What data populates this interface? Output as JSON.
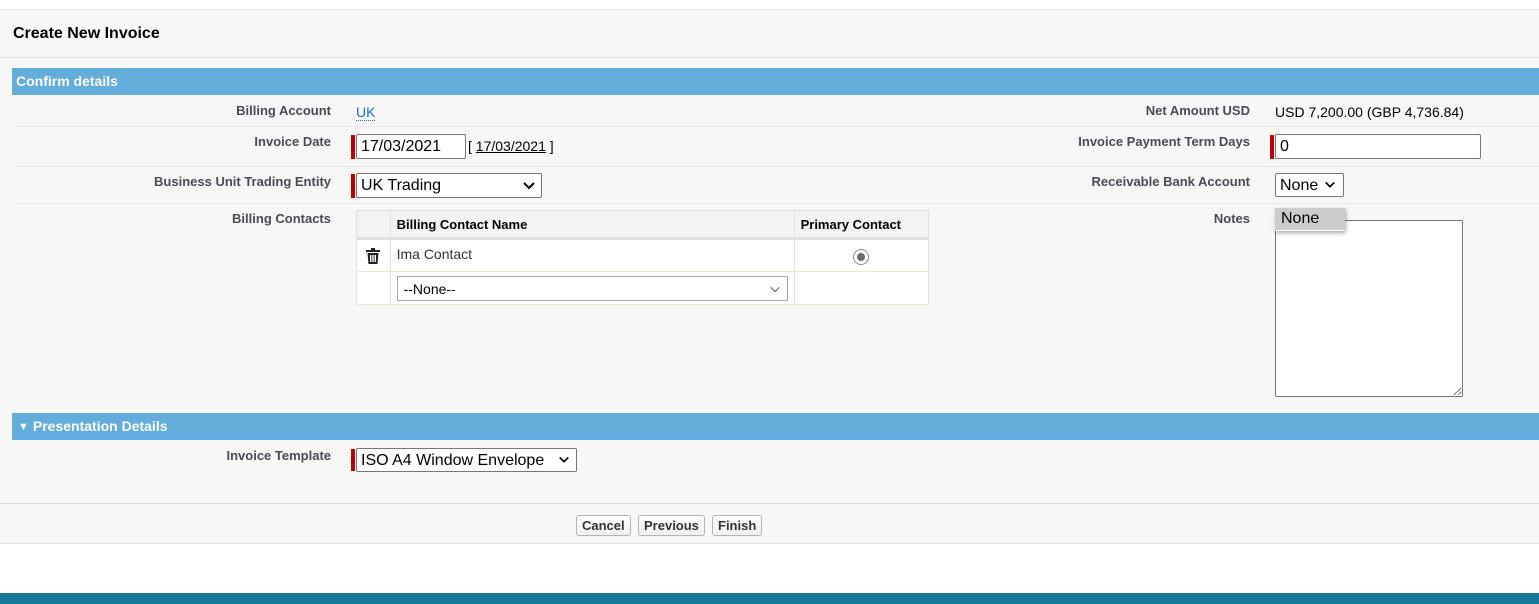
{
  "page": {
    "title": "Create New Invoice"
  },
  "sections": {
    "confirm": {
      "title": "Confirm details"
    },
    "presentation": {
      "title": "Presentation Details",
      "expanded_icon": "triangle-down-icon"
    }
  },
  "fields": {
    "billing_account": {
      "label": "Billing Account",
      "value": "UK"
    },
    "invoice_date": {
      "label": "Invoice Date",
      "value": "17/03/2021",
      "today_link": "17/03/2021",
      "bracket_open": "[",
      "bracket_close": "]"
    },
    "trading_entity": {
      "label": "Business Unit Trading Entity",
      "value": "UK Trading"
    },
    "billing_contacts": {
      "label": "Billing Contacts"
    },
    "net_amount": {
      "label": "Net Amount USD",
      "value": "USD 7,200.00 (GBP 4,736.84)"
    },
    "payment_terms": {
      "label": "Invoice Payment Term Days",
      "value": "0"
    },
    "bank_account": {
      "label": "Receivable Bank Account",
      "value": "None",
      "options": [
        "None"
      ]
    },
    "notes": {
      "label": "Notes",
      "value": ""
    },
    "invoice_template": {
      "label": "Invoice Template",
      "value": "ISO A4 Window Envelope"
    }
  },
  "contacts_table": {
    "headers": [
      "",
      "Billing Contact Name",
      "Primary Contact"
    ],
    "rows": [
      {
        "delete_icon": "trash-icon",
        "name": "Ima Contact",
        "primary": true
      }
    ],
    "new_row_select": "--None--"
  },
  "footer": {
    "cancel": "Cancel",
    "previous": "Previous",
    "finish": "Finish"
  },
  "colors": {
    "section_bar": "#62addb",
    "required_marker": "#c00000",
    "link": "#1a6fc4",
    "bottom_band": "#15789b"
  }
}
